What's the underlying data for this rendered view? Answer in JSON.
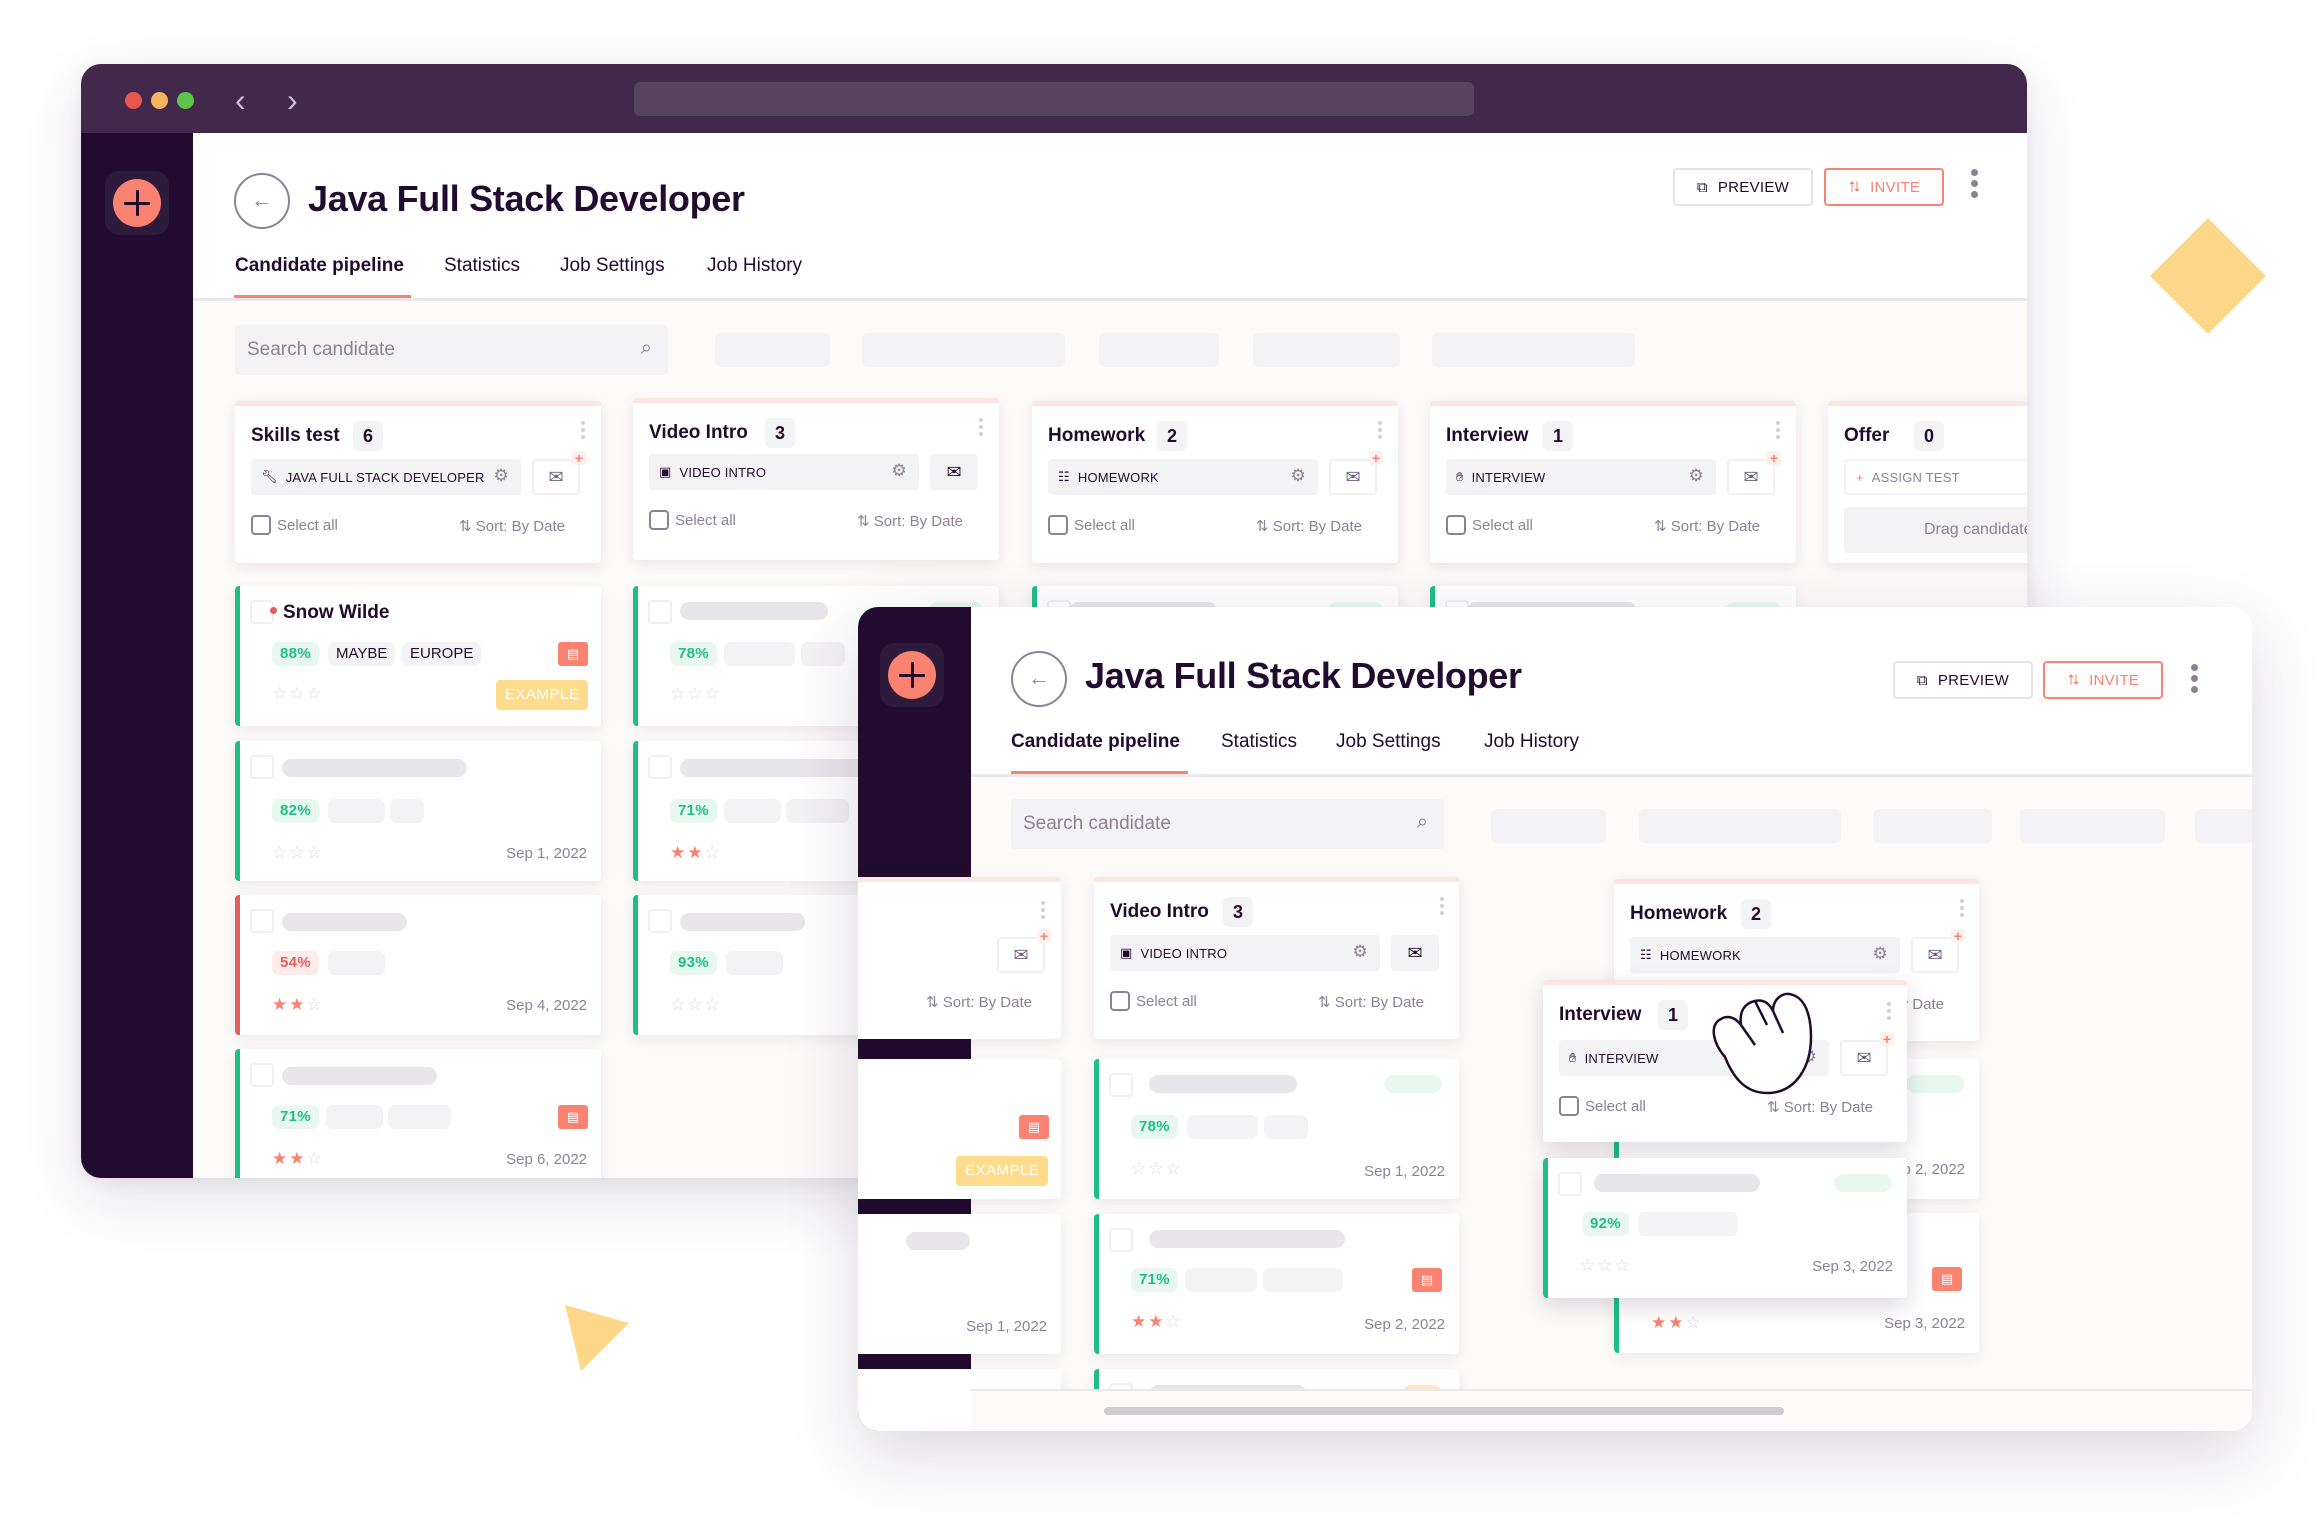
{
  "back_window": {
    "title": "Java Full Stack Developer",
    "tabs": [
      {
        "label": "Candidate pipeline",
        "active": true
      },
      {
        "label": "Statistics",
        "active": false
      },
      {
        "label": "Job Settings",
        "active": false
      },
      {
        "label": "Job History",
        "active": false
      }
    ],
    "preview_label": "PREVIEW",
    "invite_label": "INVITE",
    "search_placeholder": "Search candidate",
    "columns": [
      {
        "title": "Skills test",
        "count": "6",
        "stage": "JAVA FULL STACK DEVELOPER",
        "stage_icon": "wrench-icon",
        "select_all": "Select all",
        "sort": "Sort: By Date"
      },
      {
        "title": "Video Intro",
        "count": "3",
        "stage": "VIDEO INTRO",
        "stage_icon": "video-icon",
        "select_all": "Select all",
        "sort": "Sort: By Date"
      },
      {
        "title": "Homework",
        "count": "2",
        "stage": "HOMEWORK",
        "stage_icon": "clipboard-icon",
        "select_all": "Select all",
        "sort": "Sort: By Date"
      },
      {
        "title": "Interview",
        "count": "1",
        "stage": "INTERVIEW",
        "stage_icon": "hand-icon",
        "select_all": "Select all",
        "sort": "Sort: By Date"
      },
      {
        "title": "Offer",
        "count": "0",
        "stage": "ASSIGN TEST",
        "stage_icon": "plus-icon",
        "drop_text": "Drag candidates"
      }
    ],
    "cards": {
      "skills_test": [
        {
          "name": "Snow Wilde",
          "score": "88%",
          "tags": [
            "MAYBE",
            "EUROPE"
          ],
          "badge": "EXAMPLE",
          "rating": 0,
          "has_doc": true
        },
        {
          "score": "82%",
          "rating": 0,
          "date": "Sep 1, 2022"
        },
        {
          "score": "54%",
          "rating": 2,
          "date": "Sep 4, 2022"
        },
        {
          "score": "71%",
          "rating": 2,
          "date": "Sep 6, 2022",
          "has_doc": true
        }
      ],
      "video_intro": [
        {
          "score": "78%",
          "rating": 0
        },
        {
          "score": "71%",
          "rating": 2
        },
        {
          "score": "93%",
          "rating": 0
        }
      ]
    }
  },
  "front_window": {
    "title": "Java Full Stack Developer",
    "tabs": [
      {
        "label": "Candidate pipeline",
        "active": true
      },
      {
        "label": "Statistics",
        "active": false
      },
      {
        "label": "Job Settings",
        "active": false
      },
      {
        "label": "Job History",
        "active": false
      }
    ],
    "preview_label": "PREVIEW",
    "invite_label": "INVITE",
    "search_placeholder": "Search candidate",
    "partial_column": {
      "sort": "Sort: By Date",
      "badge": "EXAMPLE",
      "date": "Sep 1, 2022"
    },
    "columns": [
      {
        "title": "Video Intro",
        "count": "3",
        "stage": "VIDEO INTRO",
        "select_all": "Select all",
        "sort": "Sort: By Date"
      },
      {
        "title": "Homework",
        "count": "2",
        "stage": "HOMEWORK",
        "select_all": "Select all",
        "sort": "Sort: By Date"
      }
    ],
    "dragged_column": {
      "title": "Interview",
      "count": "1",
      "stage": "INTERVIEW",
      "select_all": "Select all",
      "sort": "Sort: By Date"
    },
    "cards": {
      "video_intro": [
        {
          "score": "78%",
          "rating": 0,
          "date": "Sep 1, 2022"
        },
        {
          "score": "71%",
          "rating": 2,
          "date": "Sep 2, 2022",
          "has_doc": true
        }
      ],
      "interview": [
        {
          "score": "92%",
          "rating": 0,
          "date": "Sep 3, 2022"
        }
      ],
      "homework": [
        {
          "date": "Sep 2, 2022"
        },
        {
          "rating": 2,
          "date": "Sep 3, 2022",
          "has_doc": true
        }
      ]
    }
  },
  "colors": {
    "accent": "#fa8270",
    "brand_dark": "#220b2e",
    "titlebar": "#42294c",
    "success": "#1dbf85",
    "danger": "#e35d5d",
    "highlight": "#fedc8b"
  },
  "icons": {
    "window_controls": [
      "close-dot",
      "minimize-dot",
      "maximize-dot"
    ],
    "nav": [
      "chevron-left-icon",
      "chevron-right-icon"
    ]
  }
}
